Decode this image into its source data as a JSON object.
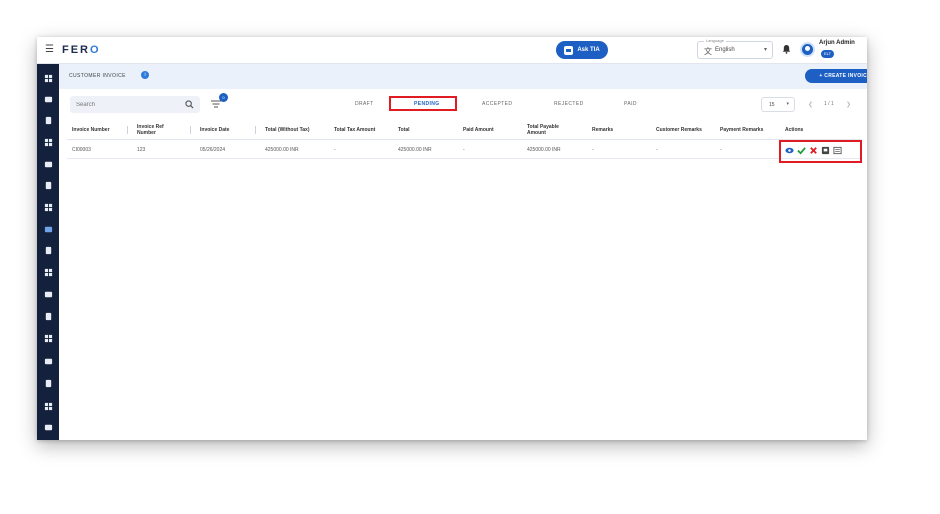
{
  "app": {
    "logo": "FERO",
    "ask_button": "Ask TIA",
    "language": {
      "caption": "Language",
      "value": "English"
    },
    "user": {
      "name": "Arjun Admin",
      "role": "ELT"
    },
    "icons": [
      "menu-icon",
      "translate-icon",
      "chevron-down-icon",
      "bell-icon",
      "avatar-icon"
    ]
  },
  "sidebar": {
    "items": [
      "dashboard",
      "catalog",
      "orders",
      "analytics",
      "shipments",
      "payments",
      "billing",
      "invoices",
      "documents",
      "transport",
      "finance",
      "reports",
      "modules",
      "apps",
      "settings",
      "storage",
      "help"
    ],
    "active_index": 7
  },
  "page": {
    "title": "CUSTOMER INVOICE",
    "create_button": "+ CREATE INVOICE",
    "search_placeholder": "Search",
    "filter_count": "0"
  },
  "tabs": [
    {
      "label": "DRAFT",
      "active": false
    },
    {
      "label": "PENDING",
      "active": true
    },
    {
      "label": "ACCEPTED",
      "active": false
    },
    {
      "label": "REJECTED",
      "active": false
    },
    {
      "label": "PAID",
      "active": false
    }
  ],
  "pagination": {
    "page_size": "15",
    "range": "1 / 1"
  },
  "table": {
    "columns": [
      "Invoice Number",
      "Invoice Ref Number",
      "Invoice Date",
      "Total (Without Tax)",
      "Total Tax Amount",
      "Total",
      "Paid Amount",
      "Total Payable Amount",
      "Remarks",
      "Customer Remarks",
      "Payment Remarks",
      "Actions"
    ],
    "rows": [
      [
        "CI00003",
        "123",
        "05/26/2024",
        "425000.00 INR",
        "-",
        "425000.00 INR",
        "-",
        "425000.00 INR",
        "-",
        "-",
        "-"
      ]
    ]
  },
  "row_actions": [
    "view-icon",
    "accept-icon",
    "reject-icon",
    "download-icon",
    "more-icon"
  ],
  "colors": {
    "sidebar": "#14213d",
    "primary": "#1e5fc4",
    "highlight": "#e01b22",
    "header_band": "#eaf1fb"
  }
}
